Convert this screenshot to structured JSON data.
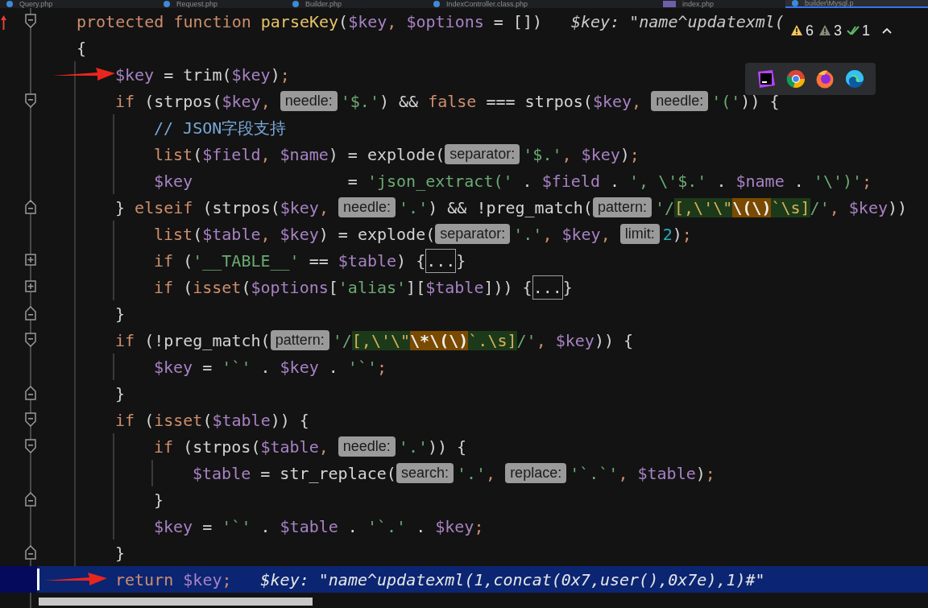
{
  "tabs": [
    {
      "label": "Query.php",
      "selected": false
    },
    {
      "label": "Request.php",
      "selected": false
    },
    {
      "label": "Builder.php",
      "selected": false
    },
    {
      "label": "IndexController.class.php",
      "selected": false
    },
    {
      "label": "index.php",
      "selected": false
    },
    {
      "label": "builder\\Mysql.p",
      "selected": true
    }
  ],
  "inspections": {
    "warnings": "6",
    "weak_warnings": "3",
    "passed": "1"
  },
  "lines": [
    {
      "kind": "block_start",
      "current": false,
      "arrow": false,
      "tokens": [
        {
          "kind": "kw",
          "text": "protected function "
        },
        {
          "kind": "fn",
          "text": "parseKey"
        },
        {
          "kind": "plain",
          "text": "("
        },
        {
          "kind": "var",
          "text": "$key"
        },
        {
          "kind": "kw",
          "text": ", "
        },
        {
          "kind": "var",
          "text": "$options"
        },
        {
          "kind": "plain",
          "text": " = [])"
        }
      ],
      "inline_value": "$key: \"name^updatexml("
    },
    {
      "kind": "plain",
      "current": false,
      "arrow": false,
      "tokens": [
        {
          "kind": "plain",
          "text": "{"
        }
      ],
      "children": [
        {
          "kind": "plain",
          "current": false,
          "arrow": true,
          "tokens": [
            {
              "kind": "var",
              "text": "$key"
            },
            {
              "kind": "plain",
              "text": " = trim("
            },
            {
              "kind": "var",
              "text": "$key"
            },
            {
              "kind": "plain",
              "text": ")"
            },
            {
              "kind": "kw",
              "text": ";"
            }
          ]
        },
        {
          "kind": "block_start",
          "current": false,
          "arrow": false,
          "tokens": [
            {
              "kind": "kw",
              "text": "if "
            },
            {
              "kind": "plain",
              "text": "(strpos("
            },
            {
              "kind": "var",
              "text": "$key"
            },
            {
              "kind": "kw",
              "text": ", "
            },
            {
              "kind": "hint",
              "text": "needle:"
            },
            {
              "kind": "str",
              "text": "'$.'"
            },
            {
              "kind": "plain",
              "text": ") && "
            },
            {
              "kind": "kw",
              "text": "false"
            },
            {
              "kind": "plain",
              "text": " === strpos("
            },
            {
              "kind": "var",
              "text": "$key"
            },
            {
              "kind": "kw",
              "text": ", "
            },
            {
              "kind": "hint",
              "text": "needle:"
            },
            {
              "kind": "str",
              "text": "'('"
            },
            {
              "kind": "plain",
              "text": ")) {"
            }
          ],
          "children": [
            {
              "kind": "plain",
              "current": false,
              "arrow": false,
              "tokens": [
                {
                  "kind": "comment",
                  "text": "// JSON字段支持"
                }
              ]
            },
            {
              "kind": "plain",
              "current": false,
              "arrow": false,
              "tokens": [
                {
                  "kind": "kw",
                  "text": "list"
                },
                {
                  "kind": "plain",
                  "text": "("
                },
                {
                  "kind": "var",
                  "text": "$field"
                },
                {
                  "kind": "kw",
                  "text": ", "
                },
                {
                  "kind": "var",
                  "text": "$name"
                },
                {
                  "kind": "plain",
                  "text": ") = explode("
                },
                {
                  "kind": "hint",
                  "text": "separator:"
                },
                {
                  "kind": "str",
                  "text": "'$.'"
                },
                {
                  "kind": "kw",
                  "text": ", "
                },
                {
                  "kind": "var",
                  "text": "$key"
                },
                {
                  "kind": "plain",
                  "text": ")"
                },
                {
                  "kind": "kw",
                  "text": ";"
                }
              ]
            },
            {
              "kind": "plain",
              "current": false,
              "arrow": false,
              "tokens": [
                {
                  "kind": "var",
                  "text": "$key"
                },
                {
                  "kind": "plain",
                  "text": "                = "
                },
                {
                  "kind": "str",
                  "text": "'json_extract('"
                },
                {
                  "kind": "plain",
                  "text": " . "
                },
                {
                  "kind": "var",
                  "text": "$field"
                },
                {
                  "kind": "plain",
                  "text": " . "
                },
                {
                  "kind": "str",
                  "text": "', \\'$.'"
                },
                {
                  "kind": "plain",
                  "text": " . "
                },
                {
                  "kind": "var",
                  "text": "$name"
                },
                {
                  "kind": "plain",
                  "text": " . "
                },
                {
                  "kind": "str",
                  "text": "'\\')'"
                },
                {
                  "kind": "kw",
                  "text": ";"
                }
              ]
            }
          ]
        },
        {
          "kind": "block_end",
          "current": false,
          "arrow": false,
          "tokens": [
            {
              "kind": "plain",
              "text": "} "
            },
            {
              "kind": "kw",
              "text": "elseif "
            },
            {
              "kind": "plain",
              "text": "(strpos("
            },
            {
              "kind": "var",
              "text": "$key"
            },
            {
              "kind": "kw",
              "text": ", "
            },
            {
              "kind": "hint",
              "text": "needle:"
            },
            {
              "kind": "str",
              "text": "'.'"
            },
            {
              "kind": "plain",
              "text": ") && !preg_match("
            },
            {
              "kind": "hint",
              "text": "pattern:"
            },
            {
              "kind": "str",
              "text": "'/"
            },
            {
              "kind": "re",
              "text": "[,\\'\\\""
            },
            {
              "kind": "re_match",
              "text": "\\(\\)"
            },
            {
              "kind": "re",
              "text": "`\\s]"
            },
            {
              "kind": "str",
              "text": "/'"
            },
            {
              "kind": "kw",
              "text": ", "
            },
            {
              "kind": "var",
              "text": "$key"
            },
            {
              "kind": "plain",
              "text": "))"
            }
          ],
          "children": [
            {
              "kind": "plain",
              "current": false,
              "arrow": false,
              "tokens": [
                {
                  "kind": "kw",
                  "text": "list"
                },
                {
                  "kind": "plain",
                  "text": "("
                },
                {
                  "kind": "var",
                  "text": "$table"
                },
                {
                  "kind": "kw",
                  "text": ", "
                },
                {
                  "kind": "var",
                  "text": "$key"
                },
                {
                  "kind": "plain",
                  "text": ") = explode("
                },
                {
                  "kind": "hint",
                  "text": "separator:"
                },
                {
                  "kind": "str",
                  "text": "'.'"
                },
                {
                  "kind": "kw",
                  "text": ", "
                },
                {
                  "kind": "var",
                  "text": "$key"
                },
                {
                  "kind": "kw",
                  "text": ", "
                },
                {
                  "kind": "hint",
                  "text": "limit:"
                },
                {
                  "kind": "num",
                  "text": "2"
                },
                {
                  "kind": "plain",
                  "text": ")"
                },
                {
                  "kind": "kw",
                  "text": ";"
                }
              ]
            },
            {
              "kind": "collapsed",
              "current": false,
              "arrow": false,
              "tokens": [
                {
                  "kind": "kw",
                  "text": "if "
                },
                {
                  "kind": "plain",
                  "text": "("
                },
                {
                  "kind": "str",
                  "text": "'__TABLE__'"
                },
                {
                  "kind": "plain",
                  "text": " == "
                },
                {
                  "kind": "var",
                  "text": "$table"
                },
                {
                  "kind": "plain",
                  "text": ") {"
                },
                {
                  "kind": "folded",
                  "text": "..."
                },
                {
                  "kind": "plain",
                  "text": "}"
                }
              ]
            },
            {
              "kind": "collapsed",
              "current": false,
              "arrow": false,
              "tokens": [
                {
                  "kind": "kw",
                  "text": "if "
                },
                {
                  "kind": "plain",
                  "text": "("
                },
                {
                  "kind": "kw",
                  "text": "isset"
                },
                {
                  "kind": "plain",
                  "text": "("
                },
                {
                  "kind": "var",
                  "text": "$options"
                },
                {
                  "kind": "plain",
                  "text": "["
                },
                {
                  "kind": "str",
                  "text": "'alias'"
                },
                {
                  "kind": "plain",
                  "text": "]["
                },
                {
                  "kind": "var",
                  "text": "$table"
                },
                {
                  "kind": "plain",
                  "text": "])) {"
                },
                {
                  "kind": "folded",
                  "text": "..."
                },
                {
                  "kind": "plain",
                  "text": "}"
                }
              ]
            }
          ]
        },
        {
          "kind": "block_end",
          "current": false,
          "arrow": false,
          "tokens": [
            {
              "kind": "plain",
              "text": "}"
            }
          ]
        },
        {
          "kind": "block_start",
          "current": false,
          "arrow": false,
          "tokens": [
            {
              "kind": "kw",
              "text": "if "
            },
            {
              "kind": "plain",
              "text": "(!preg_match("
            },
            {
              "kind": "hint",
              "text": "pattern:"
            },
            {
              "kind": "str",
              "text": "'/"
            },
            {
              "kind": "re",
              "text": "[,\\'\\\""
            },
            {
              "kind": "re_match",
              "text": "\\*\\(\\)"
            },
            {
              "kind": "re",
              "text": "`.\\s]"
            },
            {
              "kind": "str",
              "text": "/'"
            },
            {
              "kind": "kw",
              "text": ", "
            },
            {
              "kind": "var",
              "text": "$key"
            },
            {
              "kind": "plain",
              "text": ")) {"
            }
          ],
          "children": [
            {
              "kind": "plain",
              "current": false,
              "arrow": false,
              "tokens": [
                {
                  "kind": "var",
                  "text": "$key"
                },
                {
                  "kind": "plain",
                  "text": " = "
                },
                {
                  "kind": "str",
                  "text": "'`'"
                },
                {
                  "kind": "plain",
                  "text": " . "
                },
                {
                  "kind": "var",
                  "text": "$key"
                },
                {
                  "kind": "plain",
                  "text": " . "
                },
                {
                  "kind": "str",
                  "text": "'`'"
                },
                {
                  "kind": "kw",
                  "text": ";"
                }
              ]
            }
          ]
        },
        {
          "kind": "block_end",
          "current": false,
          "arrow": false,
          "tokens": [
            {
              "kind": "plain",
              "text": "}"
            }
          ]
        },
        {
          "kind": "block_start",
          "current": false,
          "arrow": false,
          "tokens": [
            {
              "kind": "kw",
              "text": "if "
            },
            {
              "kind": "plain",
              "text": "("
            },
            {
              "kind": "kw",
              "text": "isset"
            },
            {
              "kind": "plain",
              "text": "("
            },
            {
              "kind": "var",
              "text": "$table"
            },
            {
              "kind": "plain",
              "text": ")) {"
            }
          ],
          "children": [
            {
              "kind": "block_start",
              "current": false,
              "arrow": false,
              "tokens": [
                {
                  "kind": "kw",
                  "text": "if "
                },
                {
                  "kind": "plain",
                  "text": "(strpos("
                },
                {
                  "kind": "var",
                  "text": "$table"
                },
                {
                  "kind": "kw",
                  "text": ", "
                },
                {
                  "kind": "hint",
                  "text": "needle:"
                },
                {
                  "kind": "str",
                  "text": "'.'"
                },
                {
                  "kind": "plain",
                  "text": ")) {"
                }
              ],
              "children": [
                {
                  "kind": "plain",
                  "current": false,
                  "arrow": false,
                  "tokens": [
                    {
                      "kind": "var",
                      "text": "$table"
                    },
                    {
                      "kind": "plain",
                      "text": " = str_replace("
                    },
                    {
                      "kind": "hint",
                      "text": "search:"
                    },
                    {
                      "kind": "str",
                      "text": "'.'"
                    },
                    {
                      "kind": "kw",
                      "text": ", "
                    },
                    {
                      "kind": "hint",
                      "text": "replace:"
                    },
                    {
                      "kind": "str",
                      "text": "'`.`'"
                    },
                    {
                      "kind": "kw",
                      "text": ", "
                    },
                    {
                      "kind": "var",
                      "text": "$table"
                    },
                    {
                      "kind": "plain",
                      "text": ")"
                    },
                    {
                      "kind": "kw",
                      "text": ";"
                    }
                  ]
                }
              ]
            },
            {
              "kind": "block_end",
              "current": false,
              "arrow": false,
              "tokens": [
                {
                  "kind": "plain",
                  "text": "}"
                }
              ]
            },
            {
              "kind": "plain",
              "current": false,
              "arrow": false,
              "tokens": [
                {
                  "kind": "var",
                  "text": "$key"
                },
                {
                  "kind": "plain",
                  "text": " = "
                },
                {
                  "kind": "str",
                  "text": "'`'"
                },
                {
                  "kind": "plain",
                  "text": " . "
                },
                {
                  "kind": "var",
                  "text": "$table"
                },
                {
                  "kind": "plain",
                  "text": " . "
                },
                {
                  "kind": "str",
                  "text": "'`.'"
                },
                {
                  "kind": "plain",
                  "text": " . "
                },
                {
                  "kind": "var",
                  "text": "$key"
                },
                {
                  "kind": "kw",
                  "text": ";"
                }
              ]
            }
          ]
        },
        {
          "kind": "block_end",
          "current": false,
          "arrow": false,
          "tokens": [
            {
              "kind": "plain",
              "text": "}"
            }
          ]
        },
        {
          "kind": "plain",
          "current": true,
          "arrow": true,
          "tokens": [
            {
              "kind": "kw",
              "text": "return "
            },
            {
              "kind": "var",
              "text": "$key"
            },
            {
              "kind": "kw",
              "text": ";"
            }
          ],
          "inline_value": "$key: \"name^updatexml(1,concat(0x7,user(),0x7e),1)#\""
        }
      ]
    }
  ]
}
